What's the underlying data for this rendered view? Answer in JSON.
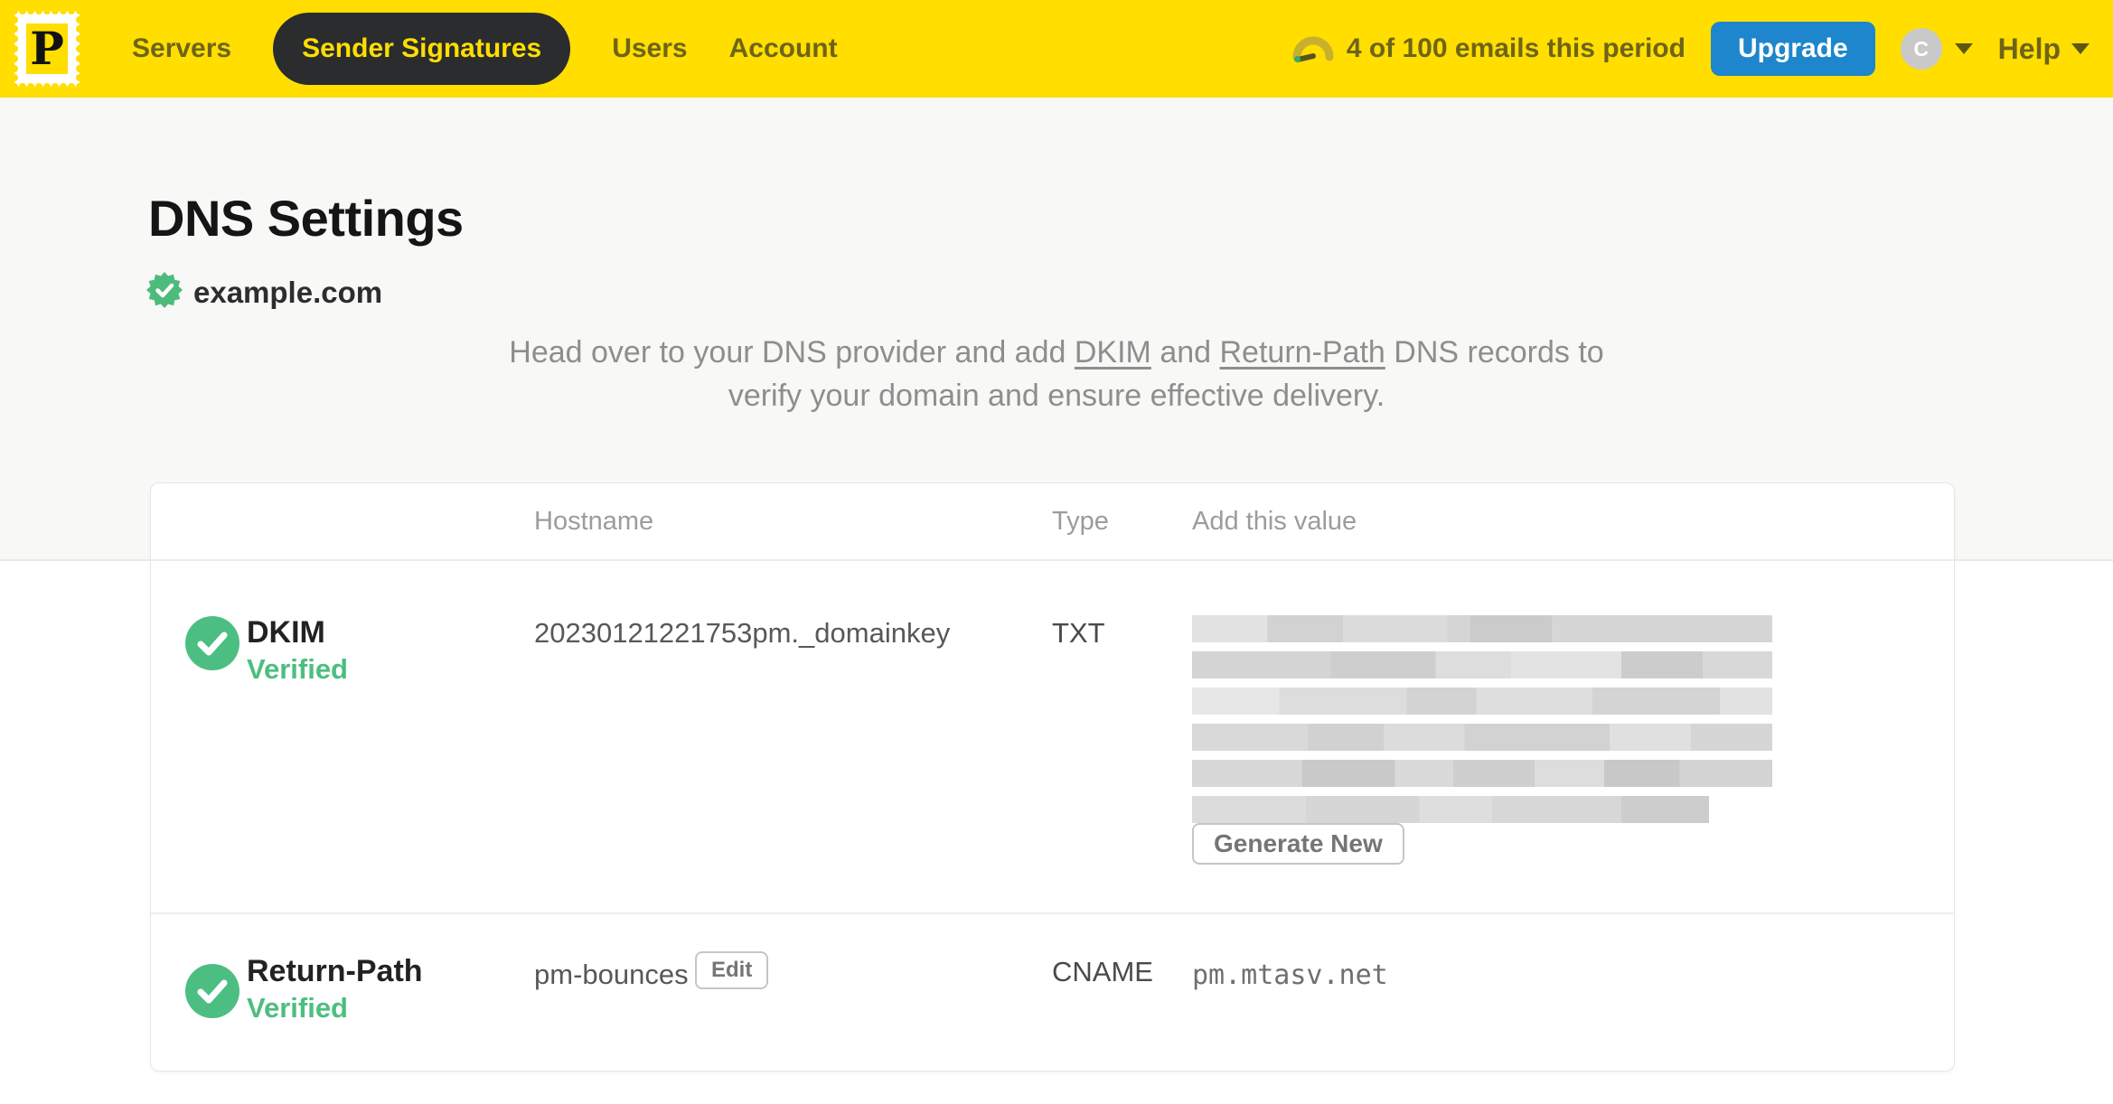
{
  "nav": {
    "logo_letter": "P",
    "items": [
      {
        "label": "Servers"
      },
      {
        "label": "Sender Signatures"
      },
      {
        "label": "Users"
      },
      {
        "label": "Account"
      }
    ],
    "active_item": "Sender Signatures",
    "usage_text": "4 of 100 emails this period",
    "upgrade_label": "Upgrade",
    "avatar_initial": "C",
    "help_label": "Help"
  },
  "page": {
    "title": "DNS Settings",
    "domain": "example.com",
    "domain_verified": true,
    "intro_before": "Head over to your DNS provider and add ",
    "intro_link1": "DKIM",
    "intro_middle": " and ",
    "intro_link2": "Return-Path",
    "intro_after": " DNS records to verify your domain and ensure effective delivery."
  },
  "table": {
    "columns": {
      "hostname": "Hostname",
      "type": "Type",
      "value": "Add this value"
    },
    "rows": [
      {
        "name": "DKIM",
        "status": "Verified",
        "hostname": "20230121221753pm._domainkey",
        "type": "TXT",
        "value_redacted": true,
        "redacted_lines": 6,
        "action_label": "Generate New"
      },
      {
        "name": "Return-Path",
        "status": "Verified",
        "hostname": "pm-bounces",
        "edit_label": "Edit",
        "type": "CNAME",
        "value": "pm.mtasv.net"
      }
    ]
  },
  "colors": {
    "brand_yellow": "#FFDE00",
    "nav_pill_dark": "#2A2C2E",
    "nav_text_olive": "#6E6418",
    "upgrade_blue": "#1E86CC",
    "verified_green": "#4CBE80",
    "band_gray": "#F8F8F6"
  }
}
